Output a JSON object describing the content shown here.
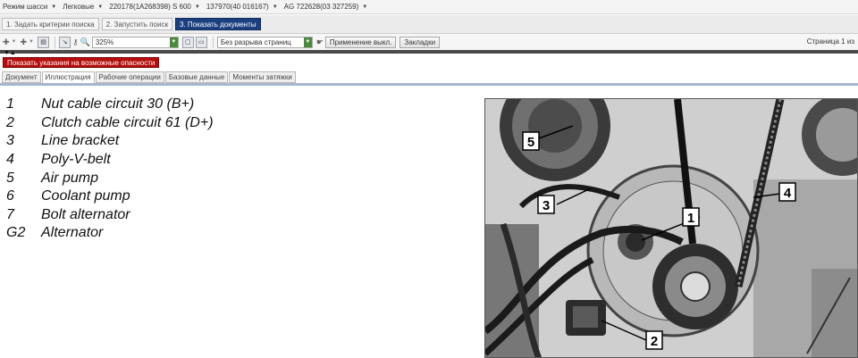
{
  "breadcrumb": [
    {
      "label": "Режим шасси"
    },
    {
      "label": "Легковые"
    },
    {
      "label": "220178(1A268398) S 600"
    },
    {
      "label": "137970(40 016167)"
    },
    {
      "label": "AG 722628(03 327259)"
    }
  ],
  "steps": [
    {
      "label": "1. Задать критерии поиска"
    },
    {
      "label": "2. Запустить поиск"
    },
    {
      "label": "3. Показать документы"
    }
  ],
  "toolbar": {
    "zoom": "325%",
    "page_mode": "Без разрыва страниц",
    "apply_label": "Применение выкл.",
    "bookmarks_label": "Закладки",
    "page_info": "Страница 1 из"
  },
  "hazard_button": "Показать указания на возможные опасности",
  "tabs": [
    {
      "label": "Документ"
    },
    {
      "label": "Иллюстрация"
    },
    {
      "label": "Рабочие операции"
    },
    {
      "label": "Базовые данные"
    },
    {
      "label": "Моменты затяжки"
    }
  ],
  "legend": [
    {
      "num": "1",
      "text": "Nut cable circuit 30 (B+)"
    },
    {
      "num": "2",
      "text": "Clutch cable circuit 61 (D+)"
    },
    {
      "num": "3",
      "text": "Line bracket"
    },
    {
      "num": "4",
      "text": "Poly-V-belt"
    },
    {
      "num": "5",
      "text": "Air pump"
    },
    {
      "num": "6",
      "text": "Coolant pump"
    },
    {
      "num": "7",
      "text": "Bolt alternator"
    },
    {
      "num": "G2",
      "text": "Alternator"
    }
  ],
  "callouts": [
    "1",
    "2",
    "3",
    "4",
    "5"
  ],
  "colors": {
    "active_step": "#1c3f80",
    "hazard": "#b60d0d",
    "combo_arrow": "#4a8a3a"
  }
}
